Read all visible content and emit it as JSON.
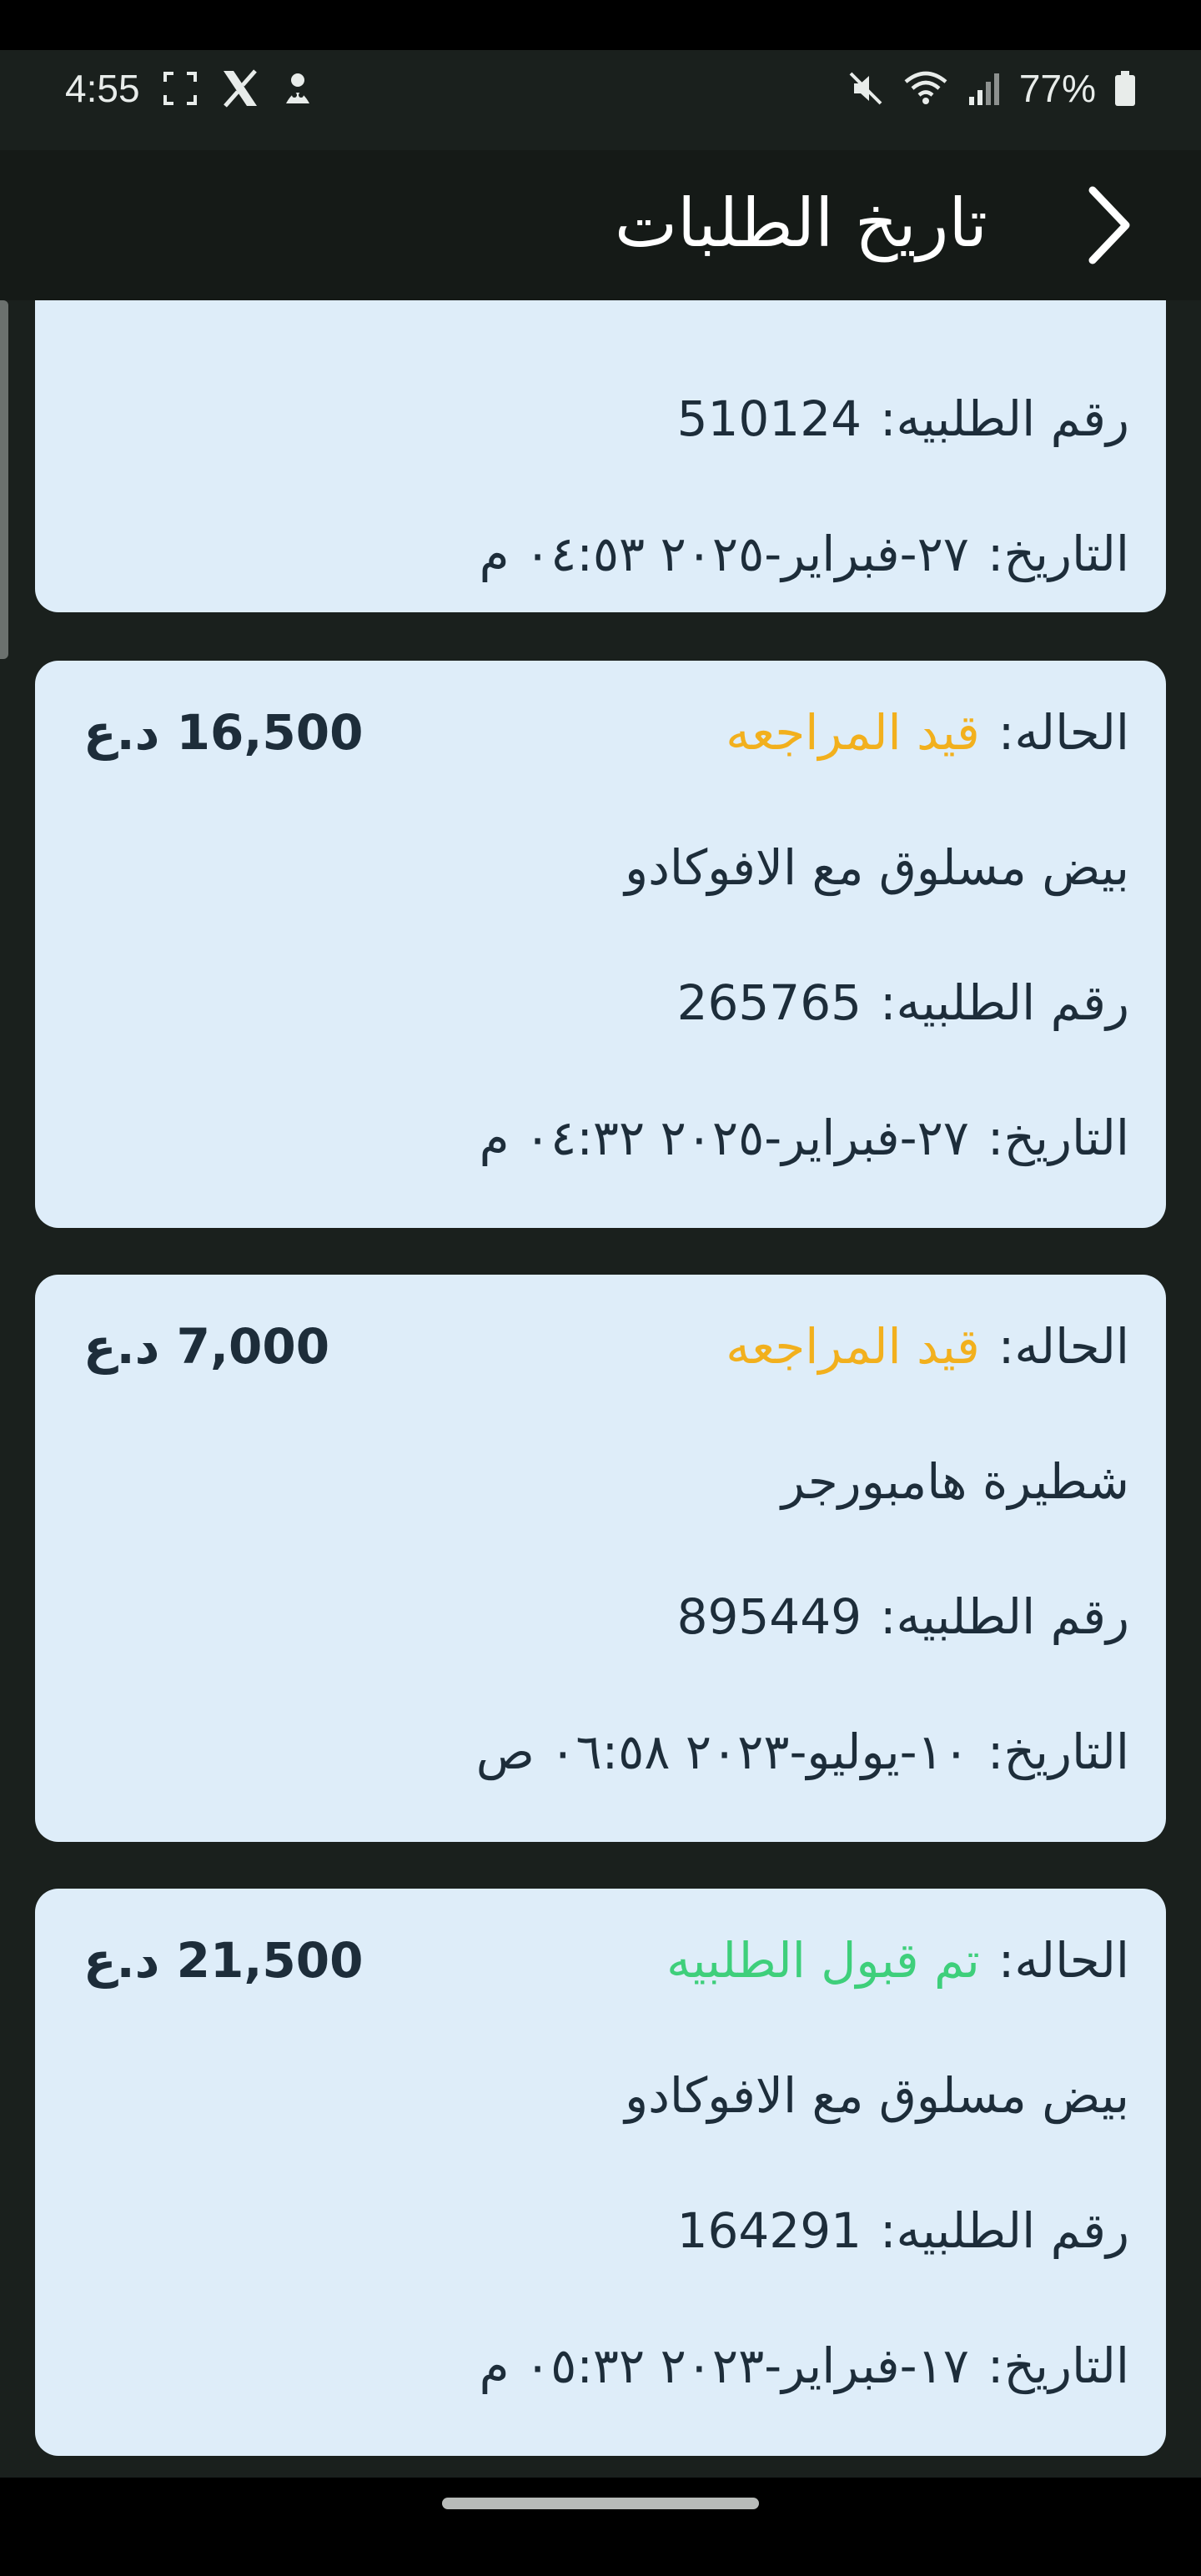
{
  "status_bar": {
    "time": "4:55",
    "battery": "77%",
    "icons_left": [
      "screenshot-frame-icon",
      "x-logo-icon",
      "mascot-icon"
    ],
    "icons_right": [
      "mute-icon",
      "wifi-icon",
      "signal-icon",
      "battery-icon"
    ]
  },
  "header": {
    "title": "تاريخ الطلبات",
    "back_icon": "chevron-right-icon"
  },
  "labels": {
    "status": "الحاله:",
    "order_number": "رقم الطلبيه:",
    "date": "التاريخ:"
  },
  "orders": [
    {
      "order_number": "510124",
      "date": "٢٧-فبراير-٢٠٢٥ ٠٤:٥٣ م"
    },
    {
      "status": "قيد المراجعه",
      "status_color": "#f2b01d",
      "price": "16,500 د.ع",
      "item": "بيض مسلوق مع الافوكادو",
      "order_number": "265765",
      "date": "٢٧-فبراير-٢٠٢٥ ٠٤:٣٢ م"
    },
    {
      "status": "قيد المراجعه",
      "status_color": "#f2b01d",
      "price": "7,000 د.ع",
      "item": "شطيرة هامبورجر",
      "order_number": "895449",
      "date": "١٠-يوليو-٢٠٢٣ ٠٦:٥٨ ص"
    },
    {
      "status": "تم قبول الطلبيه",
      "status_color": "#3ecf7b",
      "price": "21,500 د.ع",
      "item": "بيض مسلوق مع الافوكادو",
      "order_number": "164291",
      "date": "١٧-فبراير-٢٠٢٣ ٠٥:٣٢ م"
    }
  ],
  "colors": {
    "background": "#1a201d",
    "card": "#deedf9",
    "text": "#1d2d3a",
    "pending": "#f2b01d",
    "accepted": "#3ecf7b"
  }
}
